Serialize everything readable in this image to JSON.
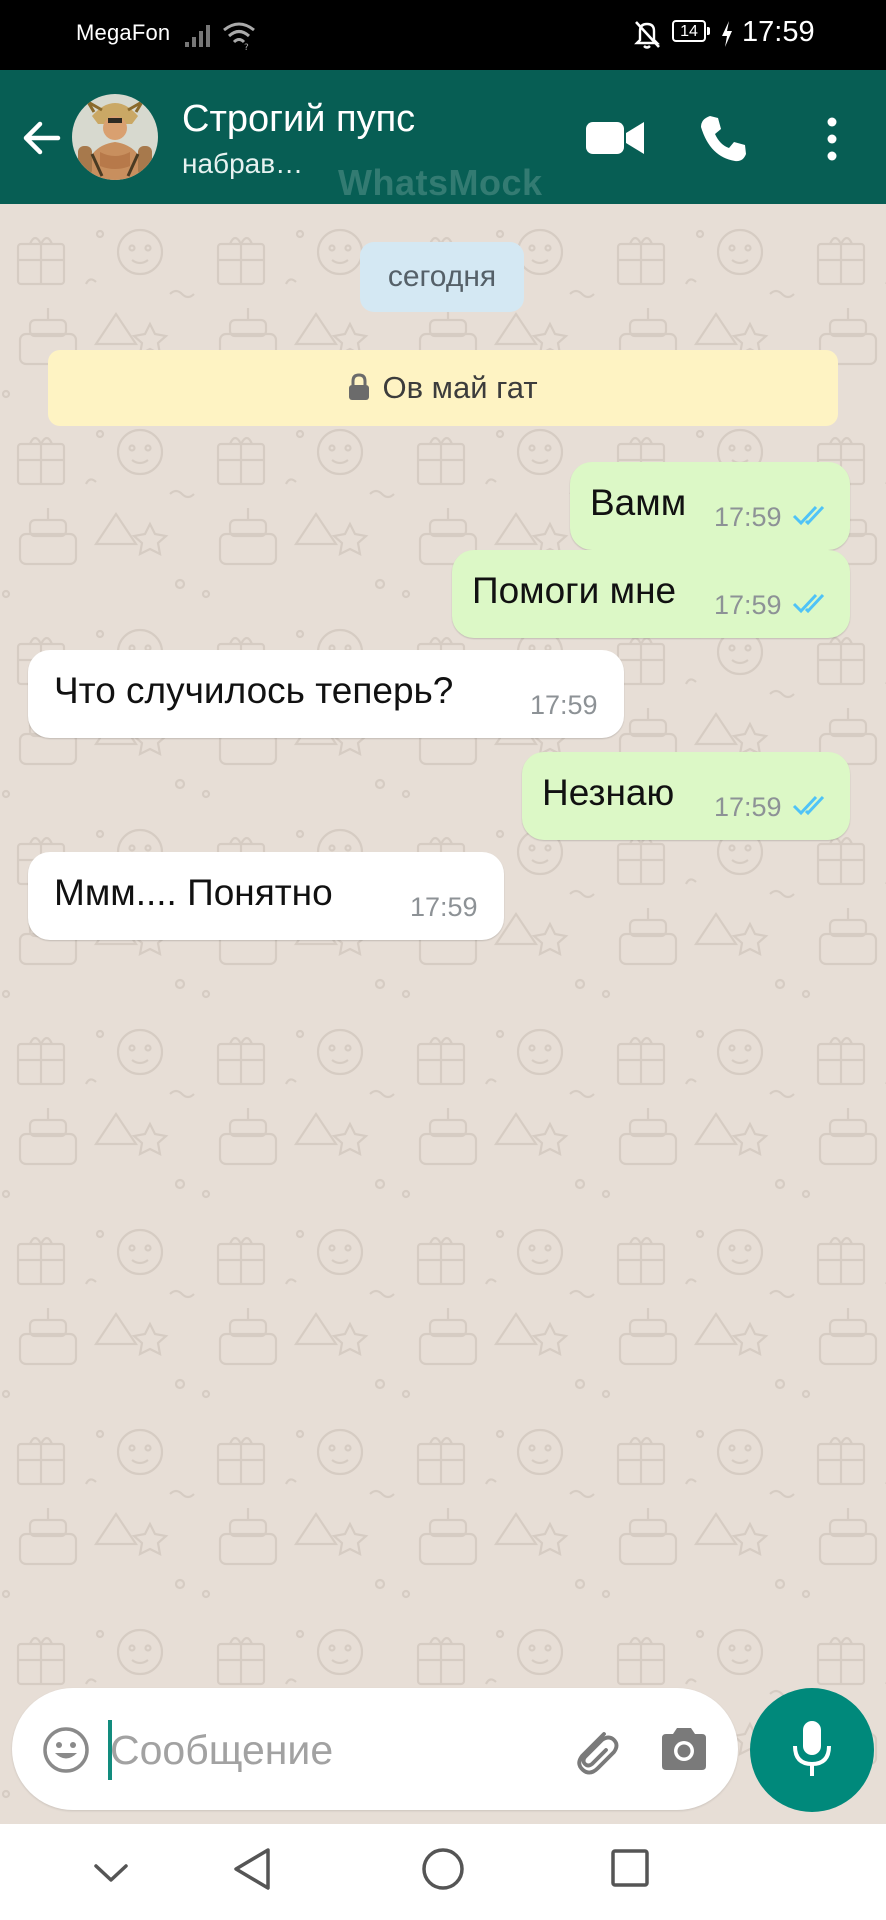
{
  "status_bar": {
    "carrier": "MegaFon",
    "battery": "14",
    "time": "17:59",
    "icons": [
      "signal-icon",
      "wifi-icon",
      "bell-muted-icon",
      "battery-icon",
      "charging-icon"
    ]
  },
  "header": {
    "contact_name": "Строгий пупс",
    "contact_status": "набрав…",
    "watermark": "WhatsMock",
    "icons": [
      "back-arrow-icon",
      "avatar",
      "video-call-icon",
      "phone-call-icon",
      "more-vert-icon"
    ],
    "color": "#075e54"
  },
  "chat": {
    "date_separator": "сегодня",
    "encryption_notice": "Ов май гат",
    "messages": [
      {
        "direction": "out",
        "text": "Вамм",
        "time": "17:59",
        "read": true
      },
      {
        "direction": "out",
        "text": "Помоги мне",
        "time": "17:59",
        "read": true
      },
      {
        "direction": "in",
        "text": "Что случилось теперь?",
        "time": "17:59"
      },
      {
        "direction": "out",
        "text": "Незнаю",
        "time": "17:59",
        "read": true
      },
      {
        "direction": "in",
        "text": "Ммм.... Понятно",
        "time": "17:59"
      }
    ],
    "colors": {
      "outgoing": "#dcf8c6",
      "incoming": "#ffffff",
      "read_ticks": "#4fc3f7"
    }
  },
  "composer": {
    "placeholder": "Сообщение",
    "value": "",
    "icons": [
      "emoji-icon",
      "attach-icon",
      "camera-icon",
      "mic-icon"
    ],
    "mic_color": "#00897b"
  },
  "nav_bar": {
    "icons": [
      "chevron-down-icon",
      "nav-back-icon",
      "nav-home-icon",
      "nav-recents-icon"
    ]
  }
}
